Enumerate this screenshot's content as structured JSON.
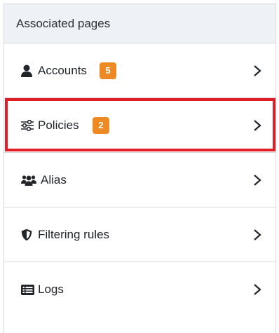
{
  "panel": {
    "title": "Associated pages",
    "items": [
      {
        "label": "Accounts",
        "icon": "user-icon",
        "badge": "5"
      },
      {
        "label": "Policies",
        "icon": "sliders-icon",
        "badge": "2"
      },
      {
        "label": "Alias",
        "icon": "users-icon",
        "badge": null
      },
      {
        "label": "Filtering rules",
        "icon": "shield-icon",
        "badge": null
      },
      {
        "label": "Logs",
        "icon": "list-icon",
        "badge": null
      }
    ]
  },
  "colors": {
    "badge": "#ee8a24",
    "highlight": "#e11d27",
    "header_bg": "#eef1f5"
  }
}
